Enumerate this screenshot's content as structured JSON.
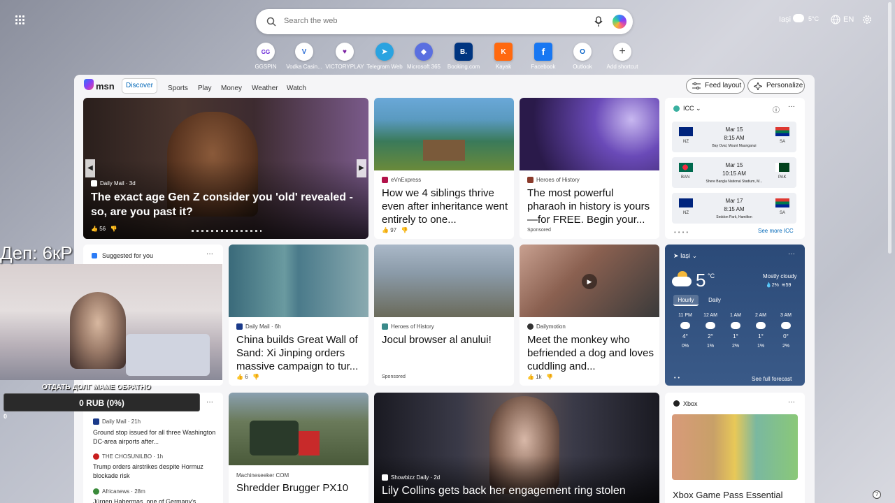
{
  "search": {
    "placeholder": "Search the web"
  },
  "topbar": {
    "location": "Iași",
    "temp": "5°C",
    "lang": "EN"
  },
  "shortcuts": [
    {
      "label": "GGSPIN",
      "icon": "GG"
    },
    {
      "label": "Vodka Casin...",
      "icon": "V"
    },
    {
      "label": "VICTORYPLAY",
      "icon": "♥"
    },
    {
      "label": "Telegram Web",
      "icon": "➤"
    },
    {
      "label": "Microsoft 365",
      "icon": "◆"
    },
    {
      "label": "Booking.com",
      "icon": "B."
    },
    {
      "label": "Kayak",
      "icon": "K"
    },
    {
      "label": "Facebook",
      "icon": "f"
    },
    {
      "label": "Outlook",
      "icon": "O"
    },
    {
      "label": "Add shortcut",
      "icon": "+"
    }
  ],
  "nav": {
    "logo": "msn",
    "tabs": [
      "Discover",
      "Sports",
      "Play",
      "Money",
      "Weather",
      "Watch"
    ],
    "feed_layout": "Feed layout",
    "personalize": "Personalize"
  },
  "hero": {
    "source": "Daily Mail · 3d",
    "title": "The exact age Gen Z consider you 'old' revealed - so, are you past it?",
    "likes": "56"
  },
  "cards": [
    {
      "source": "eVnExpress",
      "title": "How we 4 siblings thrive even after inheritance went entirely to one...",
      "likes": "97"
    },
    {
      "source": "Heroes of History",
      "title": "The most powerful pharaoh in history is yours—for FREE. Begin your...",
      "sponsored": "Sponsored"
    },
    {
      "source": "Daily Mail · 6h",
      "title": "China builds Great Wall of Sand: Xi Jinping orders massive campaign to tur...",
      "likes": "6"
    },
    {
      "source": "Heroes of History",
      "title": "Jocul browser al anului!",
      "sponsored": "Sponsored"
    },
    {
      "source": "Dailymotion",
      "title": "Meet the monkey who befriended a dog and loves cuddling and...",
      "likes": "1k"
    },
    {
      "source": "Machineseeker COM",
      "title": "Shredder Brugger PX10"
    },
    {
      "source": "Showbizz Daily · 2d",
      "title": "Lily Collins gets back her engagement ring stolen"
    }
  ],
  "icc": {
    "title": "ICC",
    "see_more": "See more ICC",
    "matches": [
      {
        "team1": "NZ",
        "team2": "SA",
        "date": "Mar 15",
        "time": "8:15 AM",
        "venue": "Bay Oval, Mount Maunganui"
      },
      {
        "team1": "BAN",
        "team2": "PAK",
        "date": "Mar 15",
        "time": "10:15 AM",
        "venue": "Shere Bangla National Stadium, M..."
      },
      {
        "team1": "NZ",
        "team2": "SA",
        "date": "Mar 17",
        "time": "8:15 AM",
        "venue": "Seddon Park, Hamilton"
      }
    ]
  },
  "weather": {
    "location": "Iași",
    "temp": "5",
    "unit": "°C",
    "condition": "Mostly cloudy",
    "precip": "2%",
    "wind": "59",
    "tabs": [
      "Hourly",
      "Daily"
    ],
    "hours": [
      {
        "t": "11 PM",
        "v": "4°",
        "p": "0%"
      },
      {
        "t": "12 AM",
        "v": "2°",
        "p": "1%"
      },
      {
        "t": "1 AM",
        "v": "1°",
        "p": "2%"
      },
      {
        "t": "2 AM",
        "v": "1°",
        "p": "1%"
      },
      {
        "t": "3 AM",
        "v": "0°",
        "p": "2%"
      }
    ],
    "see_full": "See full forecast"
  },
  "suggested": {
    "title": "Suggested for you"
  },
  "news_list": [
    {
      "source": "Daily Mail · 21h",
      "title": "Ground stop issued for all three Washington DC-area airports after..."
    },
    {
      "source": "THE CHOSUNILBO · 1h",
      "title": "Trump orders airstrikes despite Hormuz blockade risk"
    },
    {
      "source": "Africanews · 28m",
      "title": "Jürgen Habermas, one of Germany's..."
    }
  ],
  "xbox": {
    "title": "Xbox",
    "card_title": "Xbox Game Pass Essential"
  },
  "overlay": {
    "deposit": "Деп: 6кР",
    "donate": "ОТДАТЬ ДОЛГ МАМЕ ОБРАТНО",
    "progress": "0 RUB (0%)",
    "zero": "0",
    "progress_value": 0
  }
}
